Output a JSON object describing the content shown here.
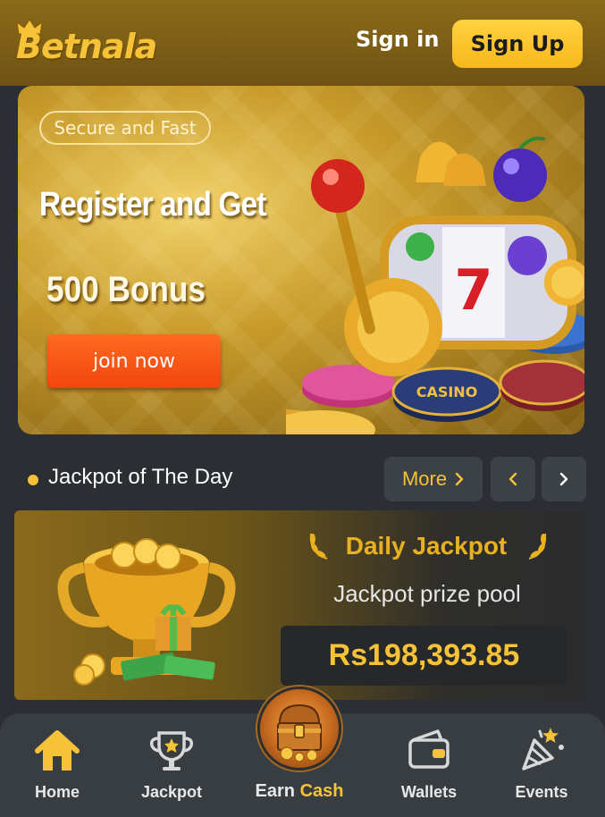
{
  "header": {
    "logo_text": "Betnala",
    "signin_label": "Sign in",
    "signup_label": "Sign Up"
  },
  "banner": {
    "badge": "Secure and Fast",
    "title": "Register and Get",
    "bonus": "500 Bonus",
    "cta": "join now"
  },
  "jackpot": {
    "section_title": "Jackpot of The Day",
    "more_label": "More",
    "card": {
      "title": "Daily Jackpot",
      "subtitle": "Jackpot prize pool",
      "amount": "Rs198,393.85"
    }
  },
  "bottom_nav": {
    "items": [
      {
        "label": "Home",
        "icon": "home-icon"
      },
      {
        "label": "Jackpot",
        "icon": "trophy-icon"
      },
      {
        "label_part1": "Earn",
        "label_part2": "Cash",
        "icon": "treasure-chest-icon"
      },
      {
        "label": "Wallets",
        "icon": "wallet-icon"
      },
      {
        "label": "Events",
        "icon": "party-popper-icon"
      }
    ]
  },
  "colors": {
    "accent": "#f6c237",
    "cta_orange": "#f2460e",
    "background": "#2b2f33",
    "nav_bg": "#383d42"
  }
}
